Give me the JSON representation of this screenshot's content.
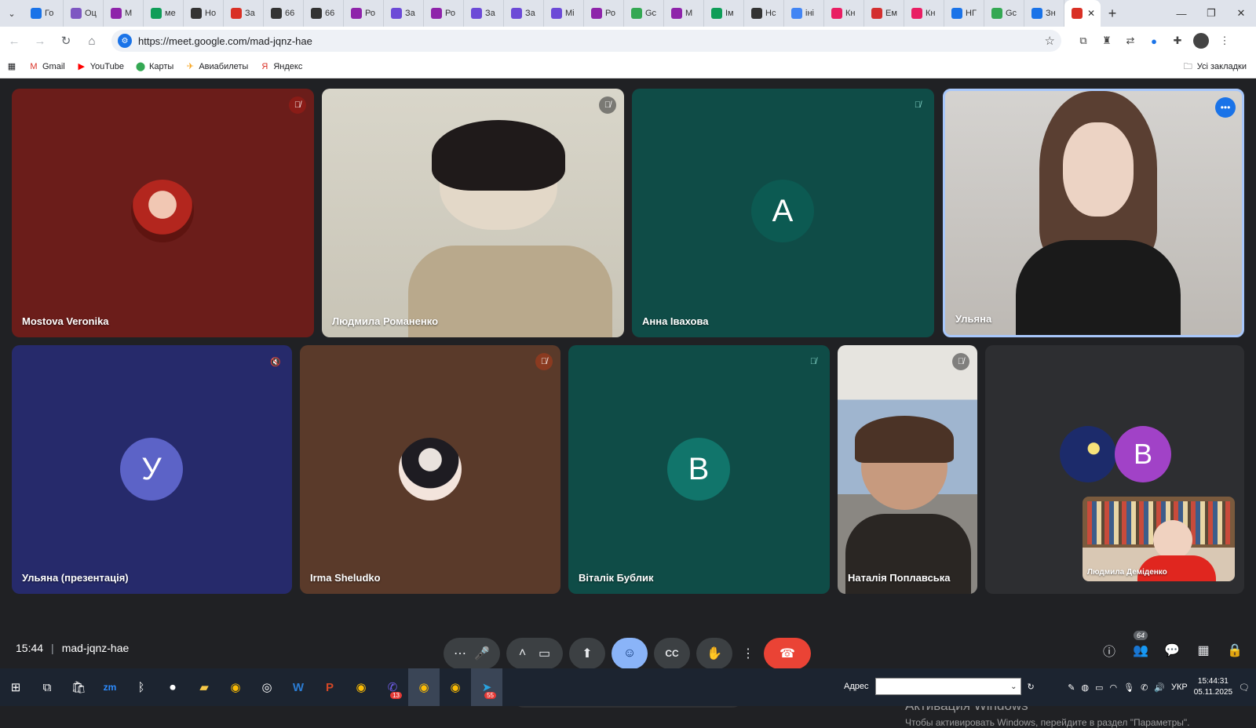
{
  "browser": {
    "tabs": [
      {
        "label": "Го",
        "color": "#1a73e8"
      },
      {
        "label": "Оц",
        "color": "#7e57c2"
      },
      {
        "label": "М",
        "color": "#8e24aa"
      },
      {
        "label": "ме",
        "color": "#0f9d58"
      },
      {
        "label": "Но",
        "color": "#333333"
      },
      {
        "label": "За",
        "color": "#d93025"
      },
      {
        "label": "66",
        "color": "#333333"
      },
      {
        "label": "66",
        "color": "#333333"
      },
      {
        "label": "Ро",
        "color": "#8e24aa"
      },
      {
        "label": "За",
        "color": "#6c4ad7"
      },
      {
        "label": "Ро",
        "color": "#8e24aa"
      },
      {
        "label": "За",
        "color": "#6c4ad7"
      },
      {
        "label": "За",
        "color": "#6c4ad7"
      },
      {
        "label": "Mi",
        "color": "#6c4ad7"
      },
      {
        "label": "Ро",
        "color": "#8e24aa"
      },
      {
        "label": "Gc",
        "color": "#34a853"
      },
      {
        "label": "М",
        "color": "#8e24aa"
      },
      {
        "label": "Ім",
        "color": "#0f9d58"
      },
      {
        "label": "Нс",
        "color": "#333333"
      },
      {
        "label": "іні",
        "color": "#4285f4"
      },
      {
        "label": "Кн",
        "color": "#e91e63"
      },
      {
        "label": "Ем",
        "color": "#d32f2f"
      },
      {
        "label": "Кн",
        "color": "#e91e63"
      },
      {
        "label": "НГ",
        "color": "#1a73e8"
      },
      {
        "label": "Gc",
        "color": "#34a853"
      },
      {
        "label": "Зн",
        "color": "#1a73e8"
      }
    ],
    "active_tab_color": "#d93025",
    "url": "https://meet.google.com/mad-jqnz-hae",
    "bookmarks": [
      {
        "label": "Gmail",
        "icon": "gmail-icon",
        "glyph": "M",
        "color": "#d93025"
      },
      {
        "label": "YouTube",
        "icon": "youtube-icon",
        "glyph": "▶",
        "color": "#ff0000"
      },
      {
        "label": "Карты",
        "icon": "maps-icon",
        "glyph": "⬤",
        "color": "#34a853"
      },
      {
        "label": "Авиабилеты",
        "icon": "plane-icon",
        "glyph": "✈",
        "color": "#f9a825"
      },
      {
        "label": "Яндекс",
        "icon": "yandex-icon",
        "glyph": "Я",
        "color": "#d93025"
      }
    ],
    "all_bookmarks_label": "Усі закладки"
  },
  "participants": [
    {
      "name": "Mostova Veronika",
      "kind": "photo-avatar",
      "bg": "#6b1d1a",
      "muted": true
    },
    {
      "name": "Людмила Романенко",
      "kind": "video",
      "bg": "#c9c5b6",
      "muted": true
    },
    {
      "name": "Анна Івахова",
      "kind": "letter",
      "letter": "А",
      "bg": "#0f4c47",
      "avatar_color": "#0c5a52",
      "muted": true
    },
    {
      "name": "Ульяна",
      "kind": "video",
      "bg": "#4a4443",
      "muted": false,
      "highlighted": true
    },
    {
      "name": "Ульяна (презентація)",
      "kind": "letter",
      "letter": "У",
      "bg": "#262a6b",
      "avatar_color": "#5c63c7",
      "muted": true
    },
    {
      "name": "Irma Sheludko",
      "kind": "photo-avatar",
      "bg": "#5a3a2a",
      "muted": true
    },
    {
      "name": "Віталік Бублик",
      "kind": "letter",
      "letter": "В",
      "bg": "#0f4c47",
      "avatar_color": "#11756b",
      "muted": true
    },
    {
      "name": "Наталія Поплавська",
      "kind": "video",
      "bg": "#8d8a83",
      "muted": true
    },
    {
      "name": "Людмила Деміденко",
      "kind": "self-view",
      "bg": "#2d2e31",
      "letter": "В",
      "avatar_color": "#a142c7"
    }
  ],
  "reactions": [
    "💖",
    "👍",
    "🎉",
    "👏",
    "😂",
    "😮",
    "😢",
    "🤔",
    "👎"
  ],
  "meeting": {
    "time": "15:44",
    "separator": "|",
    "code": "mad-jqnz-hae",
    "people_count": "64"
  },
  "controls": {
    "more": "⋯",
    "mic": "🎤",
    "up": "˄",
    "camera": "▭",
    "present": "⬆",
    "emoji": "☺",
    "captions": "CC",
    "hand": "✋",
    "options": "⋮",
    "end": "☎"
  },
  "watermark": {
    "line1": "Активация Windows",
    "line2": "Чтобы активировать Windows, перейдите в раздел \"Параметры\"."
  },
  "taskbar": {
    "address_label": "Адрес",
    "lang": "УКР",
    "time": "15:44:31",
    "date": "05.11.2025",
    "badges": {
      "viber": "13",
      "telegram": "55"
    }
  }
}
